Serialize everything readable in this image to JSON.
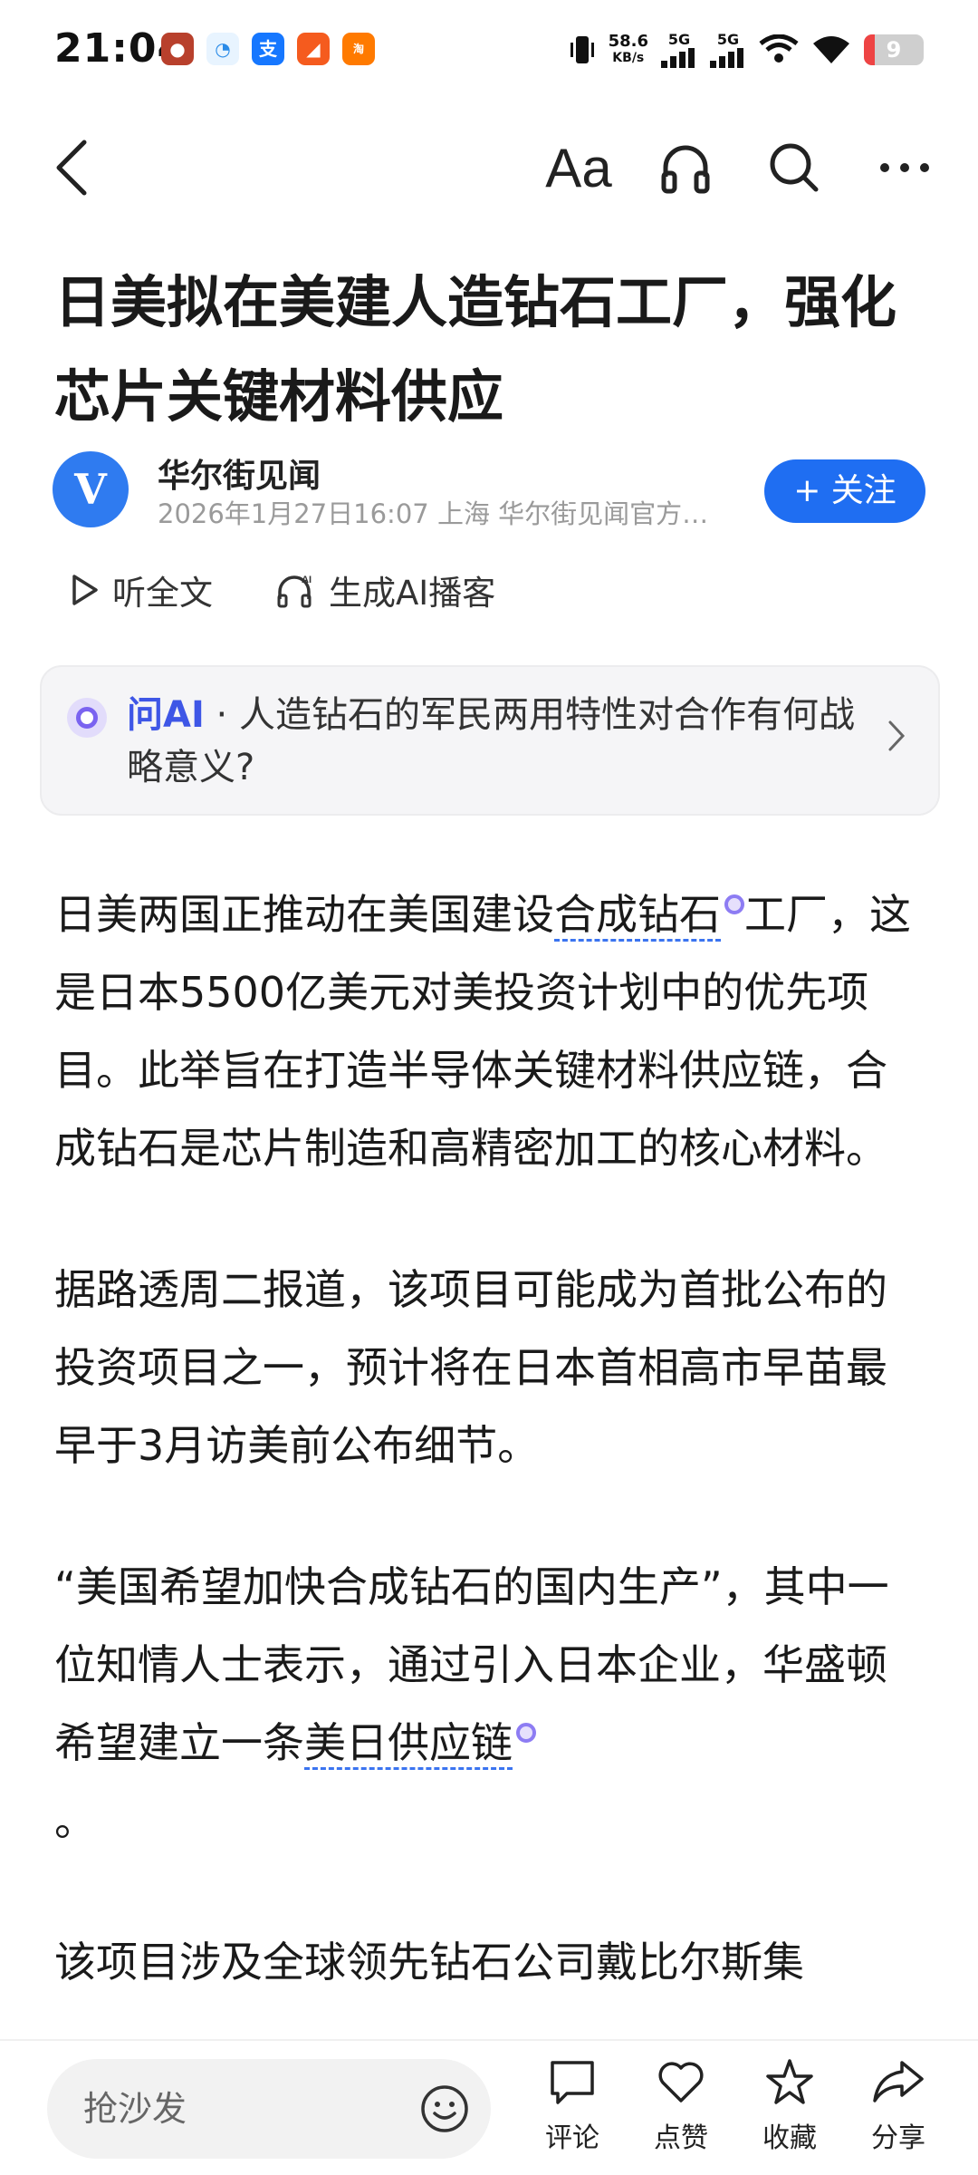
{
  "status_bar": {
    "time": "21:04",
    "net_speed_value": "58.6",
    "net_speed_unit": "KB/s",
    "net_type_1": "5G",
    "net_type_2": "5G",
    "battery": "9"
  },
  "toolbar": {
    "font_label": "Aa"
  },
  "article": {
    "title": "日美拟在美建人造钻石工厂，强化芯片关键材料供应",
    "author": {
      "avatar_letter": "V",
      "name": "华尔街见闻",
      "meta": "2026年1月27日16:07 上海 华尔街见闻官方…"
    },
    "follow_label": "+ 关注",
    "listen_label": "听全文",
    "podcast_label": "生成AI播客",
    "ask_ai": {
      "label": "问AI",
      "question": " · 人造钻石的军民两用特性对合作有何战略意义?"
    },
    "paragraphs": {
      "p1_a": "日美两国正推动在美国建设",
      "p1_link": "合成钻石",
      "p1_b": "工厂，这是日本5500亿美元对美投资计划中的优先项目。此举旨在打造半导体关键材料供应链，合成钻石是芯片制造和高精密加工的核心材料。",
      "p2": "据路透周二报道，该项目可能成为首批公布的投资项目之一，预计将在日本首相高市早苗最早于3月访美前公布细节。",
      "p3_a": "“美国希望加快合成钻石的国内生产”，其中一位知情人士表示，通过引入日本企业，华盛顿希望建立一条",
      "p3_link": "美日供应链",
      "p3_b": "。",
      "p4": "该项目涉及全球领先钻石公司戴比尔斯集"
    }
  },
  "bottom_bar": {
    "comment_placeholder": "抢沙发",
    "comment_label": "评论",
    "like_label": "点赞",
    "favorite_label": "收藏",
    "share_label": "分享"
  }
}
